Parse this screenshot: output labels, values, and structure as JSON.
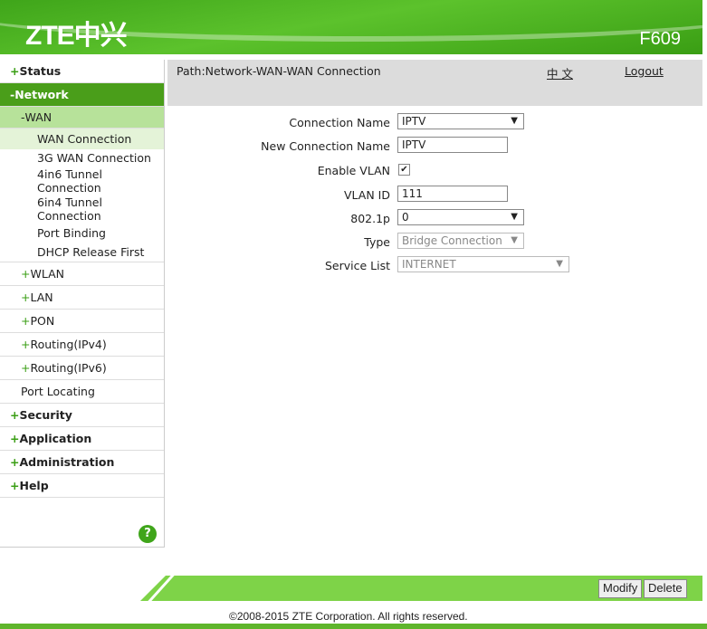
{
  "header": {
    "logo": "ZTE中兴",
    "model": "F609"
  },
  "path": {
    "text": "Path:Network-WAN-WAN Connection",
    "lang": "中 文",
    "logout": "Logout"
  },
  "sidebar": {
    "status": "Status",
    "network": "Network",
    "wan": "WAN",
    "wan_connection": "WAN Connection",
    "g3_wan": "3G WAN Connection",
    "tunnel_4in6": "4in6 Tunnel Connection",
    "tunnel_6in4": "6in4 Tunnel Connection",
    "port_binding": "Port Binding",
    "dhcp_release": "DHCP Release First",
    "wlan": "WLAN",
    "lan": "LAN",
    "pon": "PON",
    "routing_v4": "Routing(IPv4)",
    "routing_v6": "Routing(IPv6)",
    "port_locating": "Port Locating",
    "security": "Security",
    "application": "Application",
    "administration": "Administration",
    "help": "Help",
    "help_icon": "?"
  },
  "form": {
    "connection_name": {
      "label": "Connection Name",
      "value": "IPTV"
    },
    "new_connection_name": {
      "label": "New Connection Name",
      "value": "IPTV"
    },
    "enable_vlan": {
      "label": "Enable VLAN",
      "checked": true
    },
    "vlan_id": {
      "label": "VLAN ID",
      "value": "111"
    },
    "dot1p": {
      "label": "802.1p",
      "value": "0"
    },
    "type": {
      "label": "Type",
      "value": "Bridge Connection"
    },
    "service_list": {
      "label": "Service List",
      "value": "INTERNET"
    }
  },
  "footer": {
    "modify": "Modify",
    "delete": "Delete",
    "copyright": "©2008-2015 ZTE Corporation. All rights reserved."
  }
}
